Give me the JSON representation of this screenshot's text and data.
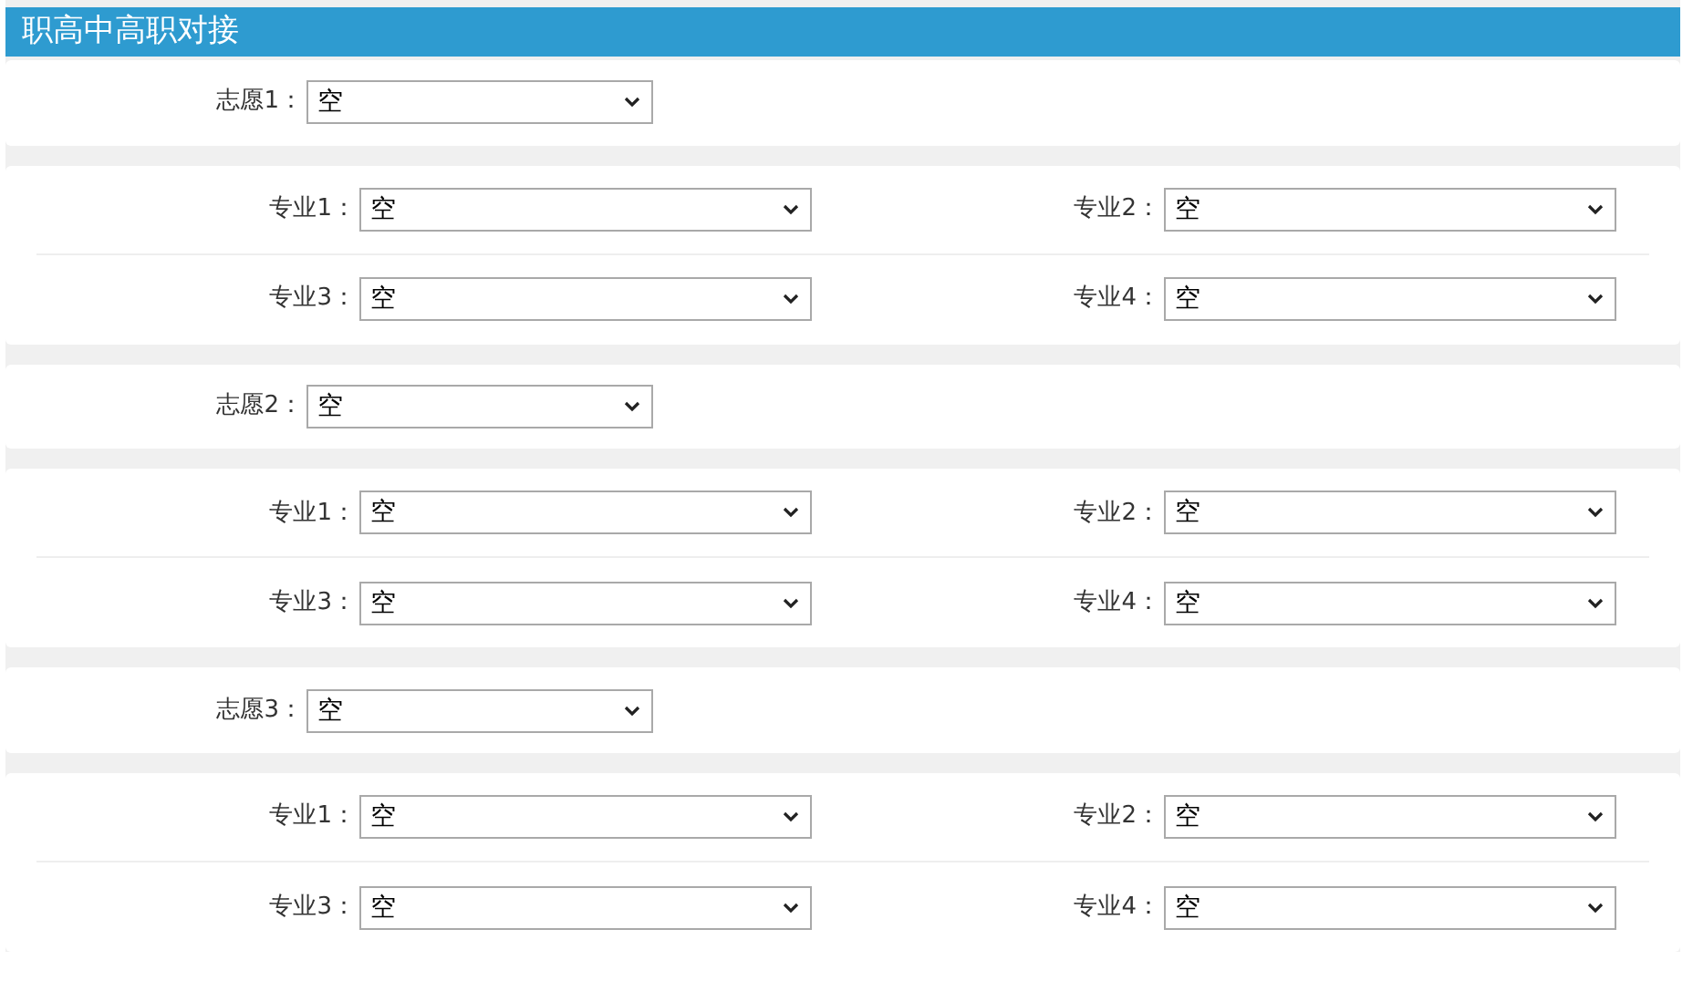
{
  "header": {
    "title": "职高中高职对接"
  },
  "choices": [
    {
      "label": "志愿1：",
      "value": "空",
      "majors": [
        {
          "label": "专业1：",
          "value": "空"
        },
        {
          "label": "专业2：",
          "value": "空"
        },
        {
          "label": "专业3：",
          "value": "空"
        },
        {
          "label": "专业4：",
          "value": "空"
        }
      ]
    },
    {
      "label": "志愿2：",
      "value": "空",
      "majors": [
        {
          "label": "专业1：",
          "value": "空"
        },
        {
          "label": "专业2：",
          "value": "空"
        },
        {
          "label": "专业3：",
          "value": "空"
        },
        {
          "label": "专业4：",
          "value": "空"
        }
      ]
    },
    {
      "label": "志愿3：",
      "value": "空",
      "majors": [
        {
          "label": "专业1：",
          "value": "空"
        },
        {
          "label": "专业2：",
          "value": "空"
        },
        {
          "label": "专业3：",
          "value": "空"
        },
        {
          "label": "专业4：",
          "value": "空"
        }
      ]
    }
  ]
}
